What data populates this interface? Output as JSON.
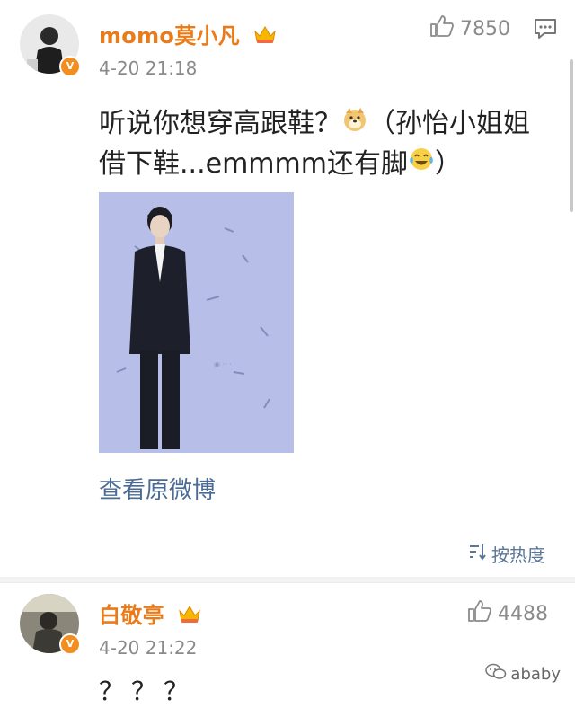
{
  "comments": [
    {
      "username": "momo莫小凡",
      "timestamp": "4-20 21:18",
      "likes": "7850",
      "text": "听说你想穿高跟鞋？",
      "text_tail": "（孙怡小姐姐借下鞋...emmmm还有脚",
      "text_close": "）",
      "view_original": "查看原微博",
      "sort_label": "按热度"
    },
    {
      "username": "白敬亭",
      "timestamp": "4-20 21:22",
      "likes": "4488",
      "text": "？？？"
    }
  ],
  "watermark": "ababy",
  "colors": {
    "username": "#e97b1a",
    "link": "#4a6b96",
    "muted": "#8a8a8a",
    "badge": "#f28d1f"
  },
  "icons": [
    "thumbs-up-icon",
    "comment-message-icon",
    "crown-icon",
    "verified-badge-icon",
    "doge-emoji-icon",
    "laugh-cry-emoji-icon",
    "sort-icon",
    "wechat-icon"
  ]
}
